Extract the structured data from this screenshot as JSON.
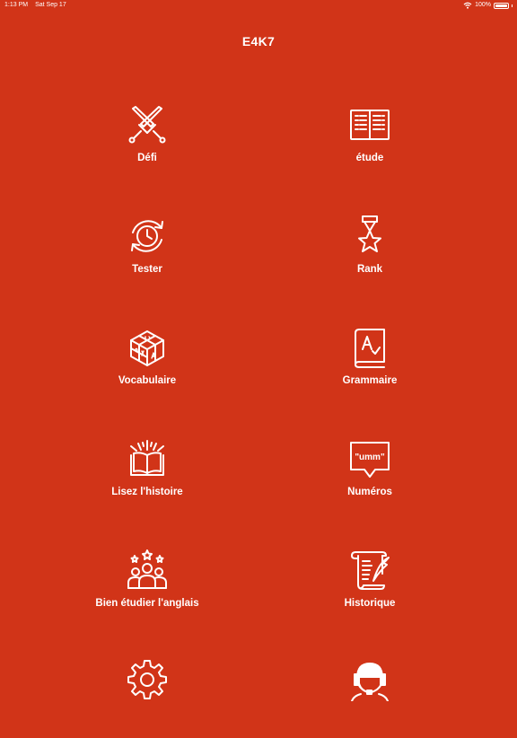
{
  "status_bar": {
    "time": "1:13 PM",
    "date": "Sat Sep 17",
    "battery": "100%",
    "battery_level": 1.0
  },
  "app": {
    "title": "E4K7"
  },
  "menu": {
    "items": [
      {
        "label": "Défi",
        "icon": "crossed-swords-icon"
      },
      {
        "label": "étude",
        "icon": "open-book-icon"
      },
      {
        "label": "Tester",
        "icon": "clock-refresh-icon"
      },
      {
        "label": "Rank",
        "icon": "star-medal-icon"
      },
      {
        "label": "Vocabulaire",
        "icon": "letter-blocks-icon"
      },
      {
        "label": "Grammaire",
        "icon": "grammar-book-icon"
      },
      {
        "label": "Lisez l'histoire",
        "icon": "magic-book-icon"
      },
      {
        "label": "Numéros",
        "icon": "speech-bubble-icon"
      },
      {
        "label": "Bien étudier l'anglais",
        "icon": "group-stars-icon"
      },
      {
        "label": "Historique",
        "icon": "scroll-quill-icon"
      },
      {
        "label": "",
        "icon": "gear-icon"
      },
      {
        "label": "",
        "icon": "support-headset-icon"
      }
    ],
    "numeros_bubble_text": "\"umm\""
  }
}
